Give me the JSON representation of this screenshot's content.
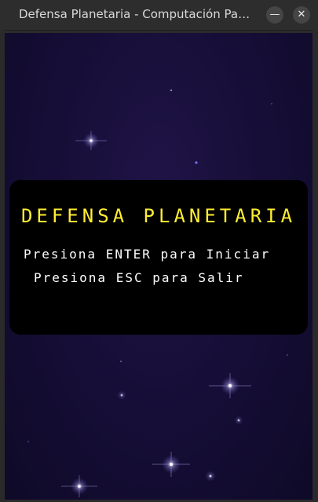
{
  "window": {
    "title": "Defensa Planetaria - Computación Paral...",
    "minimize_glyph": "—",
    "close_glyph": "✕"
  },
  "game": {
    "title": "DEFENSA PLANETARIA",
    "start_prompt": "Presiona ENTER para Iniciar",
    "quit_prompt": "Presiona ESC para Salir"
  },
  "colors": {
    "title_yellow": "#ffee33",
    "prompt_white": "#ffffff",
    "space_bg": "#180f3a"
  }
}
